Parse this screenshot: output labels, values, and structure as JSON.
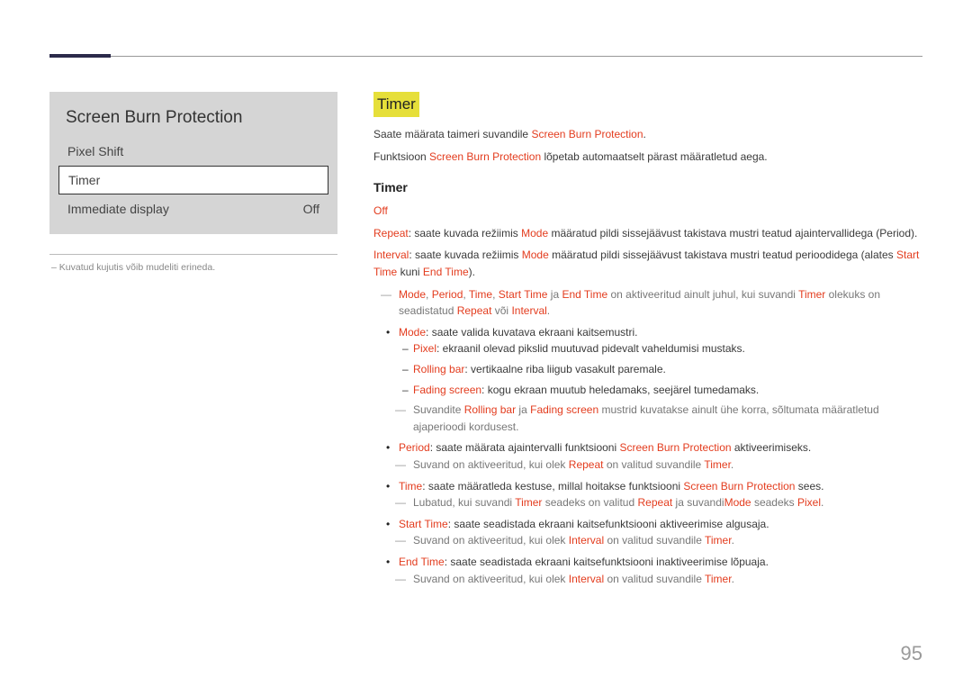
{
  "page_number": "95",
  "left": {
    "menu_title": "Screen Burn Protection",
    "pixel_shift": "Pixel Shift",
    "timer": "Timer",
    "immediate_display": "Immediate display",
    "off": "Off",
    "footnote": "Kuvatud kujutis võib mudeliti erineda."
  },
  "right": {
    "h_timer": "Timer",
    "intro1_a": "Saate määrata taimeri suvandile ",
    "intro1_b": "Screen Burn Protection",
    "intro1_c": ".",
    "intro2_a": "Funktsioon ",
    "intro2_b": "Screen Burn Protection",
    "intro2_c": " lõpetab automaatselt pärast määratletud aega.",
    "sub_timer": "Timer",
    "off": "Off",
    "repeat_lbl": "Repeat",
    "repeat_a": ": saate kuvada režiimis ",
    "repeat_mode": "Mode",
    "repeat_b": " määratud pildi sissejäävust takistava mustri teatud ajaintervallidega (Period).",
    "interval_lbl": "Interval",
    "interval_a": ": saate kuvada režiimis ",
    "interval_mode": "Mode",
    "interval_b": " määratud pildi sissejäävust takistava mustri teatud perioodidega (alates ",
    "interval_st": "Start Time",
    "interval_c": " kuni ",
    "interval_et": "End Time",
    "interval_d": ").",
    "note1_mode": "Mode",
    "note1_period": "Period",
    "note1_time": "Time",
    "note1_st": "Start Time",
    "note1_et": "End Time",
    "note1_a": ", ",
    "note1_b": " ja ",
    "note1_c": " on aktiveeritud ainult juhul, kui suvandi ",
    "note1_timer": "Timer",
    "note1_d": " olekuks on seadistatud ",
    "note1_repeat": "Repeat",
    "note1_e": " või ",
    "note1_interval": "Interval",
    "note1_f": ".",
    "mode_lbl": "Mode",
    "mode_txt": ": saate valida kuvatava ekraani kaitsemustri.",
    "pixel_lbl": "Pixel",
    "pixel_txt": ": ekraanil olevad pikslid muutuvad pidevalt vaheldumisi mustaks.",
    "rolling_lbl": "Rolling bar",
    "rolling_txt": ": vertikaalne riba liigub vasakult paremale.",
    "fading_lbl": "Fading screen",
    "fading_txt": ": kogu ekraan muutub heledamaks, seejärel tumedamaks.",
    "note2_a": "Suvandite ",
    "note2_rb": "Rolling bar",
    "note2_b": " ja ",
    "note2_fs": "Fading screen",
    "note2_c": " mustrid kuvatakse ainult ühe korra, sõltumata määratletud ajaperioodi kordusest.",
    "period_lbl": "Period",
    "period_a": ": saate määrata ajaintervalli funktsiooni ",
    "period_sbp": "Screen Burn Protection",
    "period_b": " aktiveerimiseks.",
    "note3_a": "Suvand on aktiveeritud, kui olek ",
    "note3_repeat": "Repeat",
    "note3_b": " on valitud suvandile ",
    "note3_timer": "Timer",
    "note3_c": ".",
    "time_lbl": "Time",
    "time_a": ": saate määratleda kestuse, millal hoitakse funktsiooni ",
    "time_sbp": "Screen Burn Protection",
    "time_b": " sees.",
    "note4_a": "Lubatud, kui suvandi ",
    "note4_timer": "Timer",
    "note4_b": " seadeks on valitud ",
    "note4_repeat": "Repeat",
    "note4_c": " ja suvandi",
    "note4_mode": "Mode",
    "note4_d": " seadeks ",
    "note4_pixel": "Pixel",
    "note4_e": ".",
    "starttime_lbl": "Start Time",
    "starttime_txt": ": saate seadistada ekraani kaitsefunktsiooni aktiveerimise algusaja.",
    "note5_a": "Suvand on aktiveeritud, kui olek ",
    "note5_interval": "Interval",
    "note5_b": " on valitud suvandile ",
    "note5_timer": "Timer",
    "note5_c": ".",
    "endtime_lbl": "End Time",
    "endtime_txt": ": saate seadistada ekraani kaitsefunktsiooni inaktiveerimise lõpuaja.",
    "note6_a": "Suvand on aktiveeritud, kui olek ",
    "note6_interval": "Interval",
    "note6_b": " on valitud suvandile ",
    "note6_timer": "Timer",
    "note6_c": "."
  }
}
